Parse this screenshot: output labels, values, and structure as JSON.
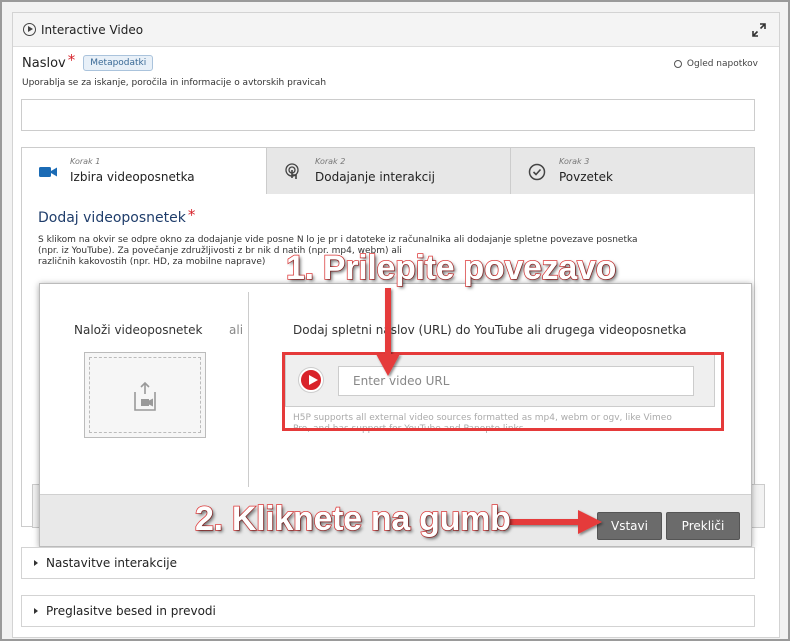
{
  "panel": {
    "title": "Interactive Video"
  },
  "title_field": {
    "label": "Naslov",
    "required_mark": "*",
    "metadata_button": "Metapodatki",
    "hint_link": "Ogled napotkov",
    "description": "Uporablja se za iskanje, poročila in informacije o avtorskih pravicah",
    "value": ""
  },
  "wizard": {
    "steps": [
      {
        "number": "Korak 1",
        "label": "Izbira videoposnetka",
        "icon": "video-camera-icon",
        "active": true
      },
      {
        "number": "Korak 2",
        "label": "Dodajanje interakcij",
        "icon": "touch-icon",
        "active": false
      },
      {
        "number": "Korak 3",
        "label": "Povzetek",
        "icon": "check-circle-icon",
        "active": false
      }
    ],
    "section_title": "Dodaj videoposnetek",
    "required_mark": "*",
    "description_lines": [
      "S klikom na okvir se odpre okno za dodajanje vide posne N   lo je pr   i datoteke iz računalnika ali dodajanje spletne povezave posnetka",
      "(npr. iz YouTube). Za povečanje združljivosti z br   nik           d                                   natih (npr. mp4, webm) ali",
      "različnih kakovostih (npr. HD, za mobilne naprave)"
    ]
  },
  "modal": {
    "upload_label": "Naloži videoposnetek",
    "or_label": "ali",
    "url_label": "Dodaj spletni naslov (URL) do YouTube ali drugega videoposnetka",
    "url_placeholder": "Enter video URL",
    "url_value": "",
    "support_line1": "H5P supports all external video sources formatted as mp4, webm or ogv, like Vimeo",
    "support_line2": "Pro, and has support for YouTube and Panopto links.",
    "insert_button": "Vstavi",
    "cancel_button": "Prekliči"
  },
  "collapsibles": [
    {
      "label": "Nastavitve interakcije"
    },
    {
      "label": "Preglasitve besed in prevodi"
    }
  ],
  "annotations": {
    "callout_1": "1. Prilepite povezavo",
    "callout_2": "2. Kliknete na gumb",
    "color": "#e53a3a"
  }
}
